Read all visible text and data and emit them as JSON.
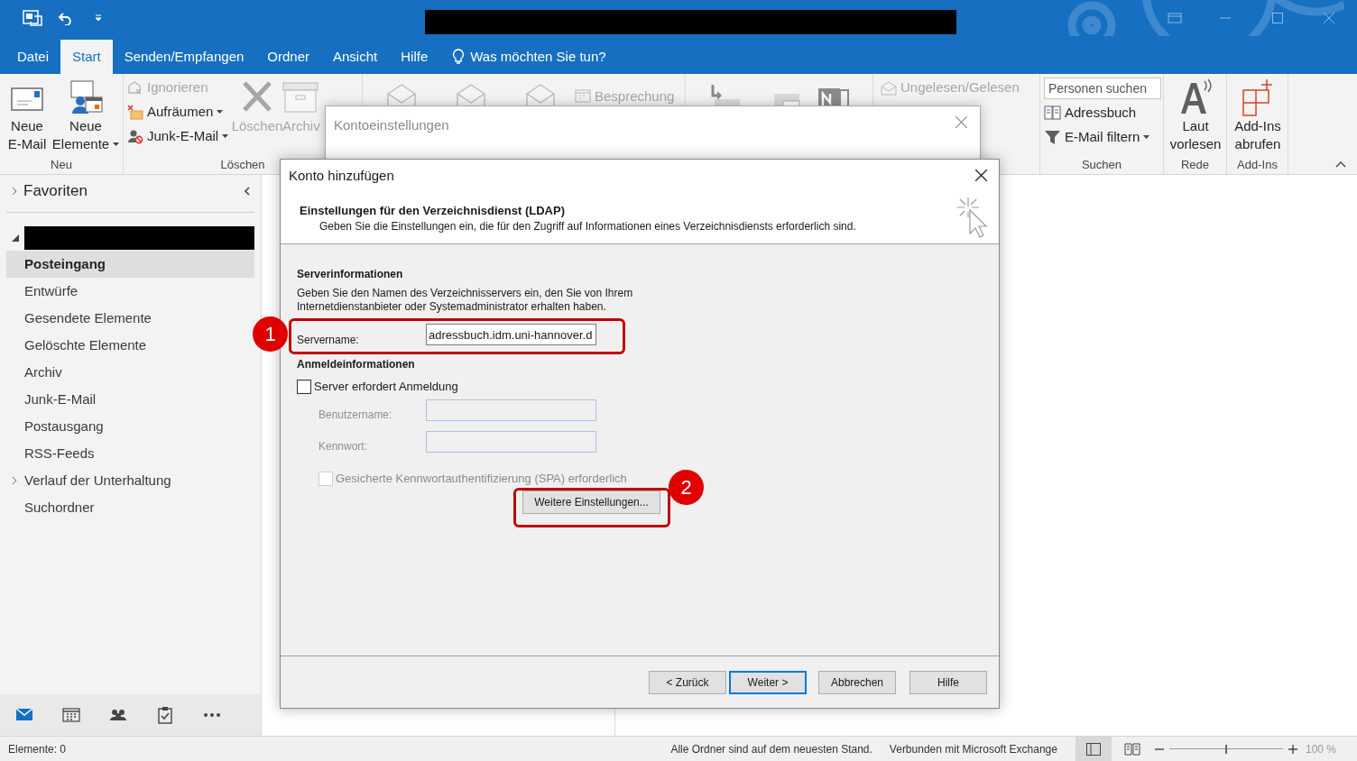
{
  "menu_tabs": [
    {
      "label": "Datei",
      "selected": false
    },
    {
      "label": "Start",
      "selected": true
    },
    {
      "label": "Senden/Empfangen",
      "selected": false
    },
    {
      "label": "Ordner",
      "selected": false
    },
    {
      "label": "Ansicht",
      "selected": false
    },
    {
      "label": "Hilfe",
      "selected": false
    }
  ],
  "tell_me": "Was möchten Sie tun?",
  "ribbon": {
    "neu": {
      "label": "Neu",
      "items": [
        {
          "lines": [
            "Neue",
            "E-Mail"
          ],
          "dropdown": false
        },
        {
          "lines": [
            "Neue",
            "Elemente"
          ],
          "dropdown": true
        }
      ]
    },
    "loeschen": {
      "label": "Löschen",
      "small": [
        {
          "label": "Ignorieren",
          "disabled": true,
          "dropdown": false
        },
        {
          "label": "Aufräumen",
          "disabled": false,
          "dropdown": true
        },
        {
          "label": "Junk-E-Mail",
          "disabled": false,
          "dropdown": true
        }
      ],
      "large": [
        {
          "label": "Löschen",
          "disabled": true
        },
        {
          "label": "Archiv",
          "disabled": true
        }
      ]
    },
    "besprechung": {
      "label": "Besprechung",
      "disabled": true
    },
    "ungelesen": {
      "label": "Ungelesen/Gelesen",
      "disabled": true
    },
    "suchen": {
      "label": "Suchen",
      "search_placeholder": "Personen suchen",
      "items": [
        {
          "label": "Adressbuch",
          "dropdown": false
        },
        {
          "label": "E-Mail filtern",
          "dropdown": true
        }
      ]
    },
    "rede": {
      "label": "Rede",
      "lines": [
        "Laut",
        "vorlesen"
      ]
    },
    "addins": {
      "label": "Add-Ins",
      "lines": [
        "Add-Ins",
        "abrufen"
      ]
    }
  },
  "nav_pane": {
    "favorites": "Favoriten",
    "folders": [
      {
        "label": "Posteingang",
        "selected": true,
        "expandable": false
      },
      {
        "label": "Entwürfe",
        "selected": false,
        "expandable": false
      },
      {
        "label": "Gesendete Elemente",
        "selected": false,
        "expandable": false
      },
      {
        "label": "Gelöschte Elemente",
        "selected": false,
        "expandable": false
      },
      {
        "label": "Archiv",
        "selected": false,
        "expandable": false
      },
      {
        "label": "Junk-E-Mail",
        "selected": false,
        "expandable": false
      },
      {
        "label": "Postausgang",
        "selected": false,
        "expandable": false
      },
      {
        "label": "RSS-Feeds",
        "selected": false,
        "expandable": false
      },
      {
        "label": "Verlauf der Unterhaltung",
        "selected": false,
        "expandable": true
      },
      {
        "label": "Suchordner",
        "selected": false,
        "expandable": false
      }
    ]
  },
  "status_bar": {
    "items_count": "Elemente: 0",
    "sync_status": "Alle Ordner sind auf dem neuesten Stand.",
    "connection": "Verbunden mit Microsoft Exchange",
    "zoom": {
      "level": 0.5,
      "reading": "100 %"
    }
  },
  "back_dialog": {
    "title": "Kontoeinstellungen"
  },
  "dialog": {
    "title": "Konto hinzufügen",
    "heading": "Einstellungen für den Verzeichnisdienst (LDAP)",
    "subheading": "Geben Sie die Einstellungen ein, die für den Zugriff auf Informationen eines Verzeichnisdiensts erforderlich sind.",
    "server_section": "Serverinformationen",
    "server_description": "Geben Sie den Namen des Verzeichnisservers ein, den Sie von Ihrem Internetdienstanbieter oder Systemadministrator erhalten haben.",
    "server_label": "Servername:",
    "server_value": "adressbuch.idm.uni-hannover.d",
    "login_section": "Anmeldeinformationen",
    "require_login": {
      "label": "Server erfordert Anmeldung",
      "checked": false
    },
    "username": {
      "label": "Benutzername:",
      "disabled": true
    },
    "password": {
      "label": "Kennwort:",
      "disabled": true
    },
    "spa": {
      "label": "Gesicherte Kennwortauthentifizierung (SPA) erforderlich",
      "checked": false,
      "disabled": true
    },
    "more_settings": "Weitere Einstellungen...",
    "buttons": [
      {
        "label": "< Zurück",
        "default": false
      },
      {
        "label": "Weiter >",
        "default": true
      },
      {
        "label": "Abbrechen",
        "default": false
      },
      {
        "label": "Hilfe",
        "default": false
      }
    ]
  },
  "callouts": [
    {
      "number": "1"
    },
    {
      "number": "2"
    }
  ]
}
